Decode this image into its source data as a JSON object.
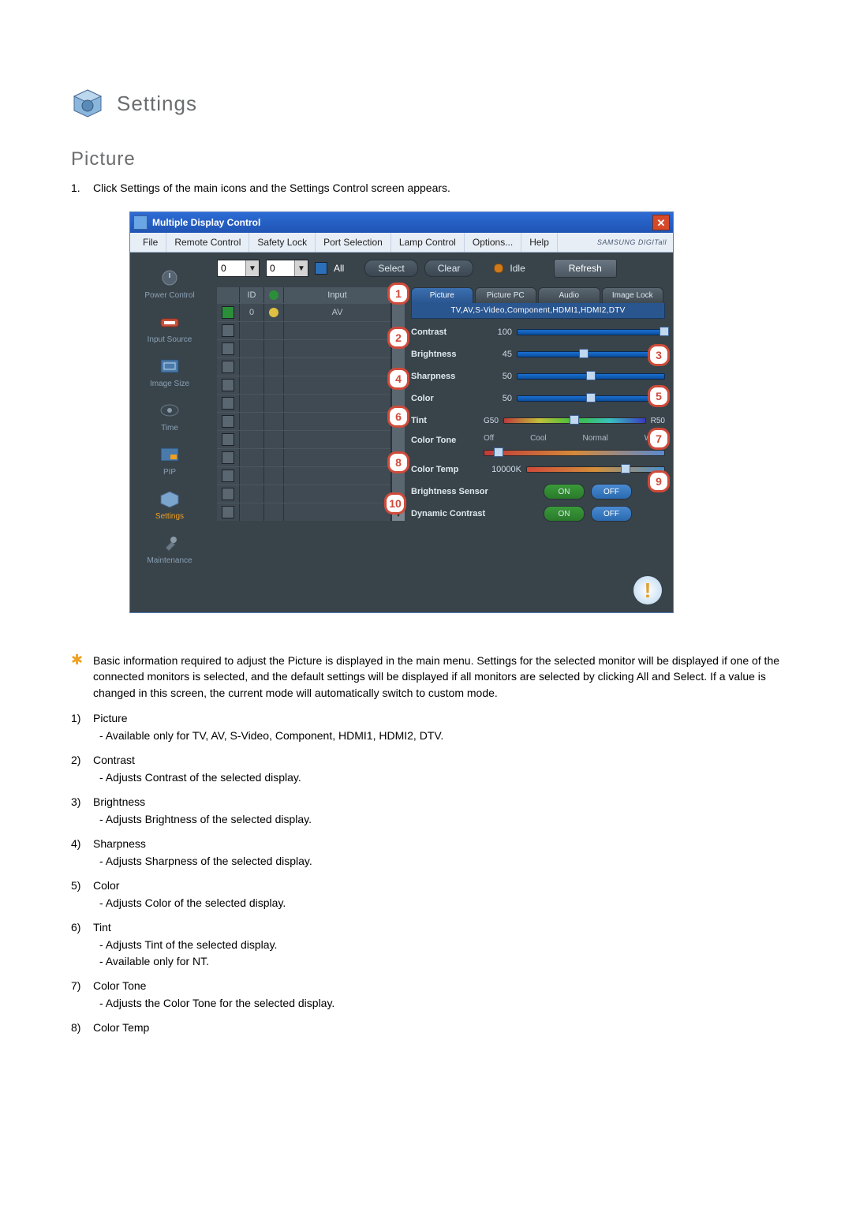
{
  "heading": "Settings",
  "section": "Picture",
  "step": {
    "num": "1.",
    "text": "Click Settings of the main icons and the Settings Control screen appears."
  },
  "window": {
    "title": "Multiple Display Control",
    "brand": "SAMSUNG DIGITall",
    "menu": [
      "File",
      "Remote Control",
      "Safety Lock",
      "Port Selection",
      "Lamp Control",
      "Options...",
      "Help"
    ],
    "filter": {
      "id_from": "0",
      "id_to": "0",
      "all_label": "All",
      "select_btn": "Select",
      "clear_btn": "Clear",
      "status_label": "Idle",
      "refresh_btn": "Refresh"
    },
    "sidebar": [
      {
        "label": "Power Control"
      },
      {
        "label": "Input Source"
      },
      {
        "label": "Image Size"
      },
      {
        "label": "Time"
      },
      {
        "label": "PIP"
      },
      {
        "label": "Settings",
        "active": true
      },
      {
        "label": "Maintenance"
      }
    ],
    "grid": {
      "hdr_check": "",
      "hdr_id": "ID",
      "hdr_status": "",
      "hdr_input": "Input",
      "row1": {
        "id": "0",
        "input": "AV"
      }
    },
    "tabs": [
      "Picture",
      "Picture PC",
      "Audio",
      "Image Lock"
    ],
    "src_line": "TV,AV,S-Video,Component,HDMI1,HDMI2,DTV",
    "settings": {
      "contrast": {
        "label": "Contrast",
        "value": "100"
      },
      "brightness": {
        "label": "Brightness",
        "value": "45"
      },
      "sharpness": {
        "label": "Sharpness",
        "value": "50"
      },
      "color": {
        "label": "Color",
        "value": "50"
      },
      "tint": {
        "label": "Tint",
        "left": "G50",
        "right": "R50"
      },
      "color_tone": {
        "label": "Color Tone",
        "opts": [
          "Off",
          "Cool",
          "Normal",
          "Warm"
        ]
      },
      "color_temp": {
        "label": "Color Temp",
        "value": "10000K"
      },
      "bright_sensor": {
        "label": "Brightness Sensor",
        "on": "ON",
        "off": "OFF"
      },
      "dynamic_contrast": {
        "label": "Dynamic Contrast",
        "on": "ON",
        "off": "OFF"
      }
    }
  },
  "callouts": [
    "1",
    "2",
    "3",
    "4",
    "5",
    "6",
    "7",
    "8",
    "9",
    "10"
  ],
  "note_star": "✱",
  "note_text": "Basic information required to adjust the Picture is displayed in the main menu. Settings for the selected monitor will be displayed if one of the connected monitors is selected, and the default settings will be displayed if all monitors are selected by clicking All and Select. If a value is changed in this screen, the current mode will automatically switch to custom mode.",
  "list": [
    {
      "n": "1)",
      "title": "Picture",
      "subs": [
        "Available only for TV, AV, S-Video, Component, HDMI1, HDMI2, DTV."
      ]
    },
    {
      "n": "2)",
      "title": "Contrast",
      "subs": [
        "Adjusts Contrast of the selected display."
      ]
    },
    {
      "n": "3)",
      "title": "Brightness",
      "subs": [
        "Adjusts Brightness of the selected display."
      ]
    },
    {
      "n": "4)",
      "title": "Sharpness",
      "subs": [
        "Adjusts Sharpness of the selected display."
      ]
    },
    {
      "n": "5)",
      "title": "Color",
      "subs": [
        "Adjusts Color of the selected display."
      ]
    },
    {
      "n": "6)",
      "title": "Tint",
      "subs": [
        "Adjusts Tint of the selected display.",
        "Available  only for NT."
      ]
    },
    {
      "n": "7)",
      "title": "Color Tone",
      "subs": [
        "Adjusts the Color Tone for the selected display."
      ]
    },
    {
      "n": "8)",
      "title": "Color Temp",
      "subs": []
    }
  ]
}
